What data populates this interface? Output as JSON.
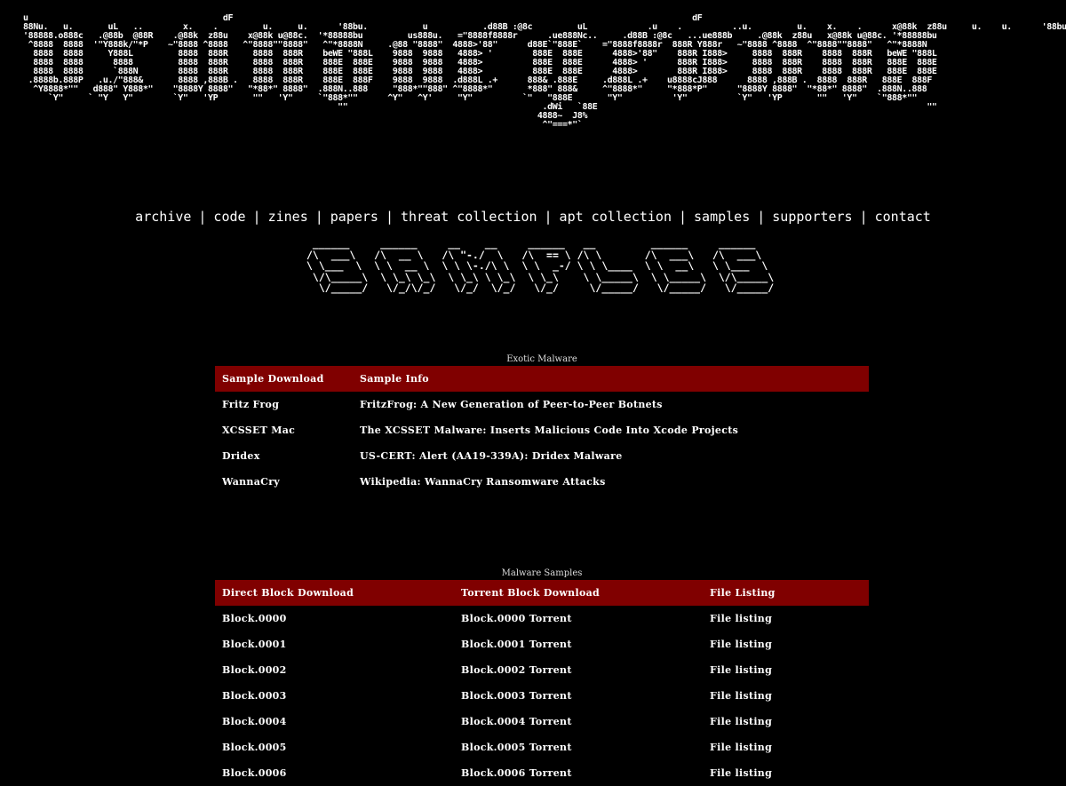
{
  "logo": {
    "ascii": "u                                       dF                                                                                            dF\n88Nu.   u.       uL   ..        x.    .         u.     u.      '88bu.           u           .d88B :@8c         uL            .u    .          ..u.         u.    x.    .      x@88k  z88u     u.    u.      '88bu.\n'88888.o888c   .@88b  @88R    .@88k  z88u    x@88k u@88c.  '*88888bu         us888u.   =\"8888f8888r      .ue888Nc..     .d88B :@8c   ...ue888b     .@88k  z88u   x@88k u@88c. '*88888bu\n ^8888  8888  '\"Y888k/\"*P    ~\"8888 ^8888   ^\"8888\"\"8888\"   ^\"*8888N     .@88 \"8888\"  4888>'88\"      d88E`\"888E`    =\"8888f8888r  888R Y888r   ~\"8888 ^8888  ^\"8888\"\"8888\"   ^\"*8888N\n  8888  8888     Y888L         8888  888R     8888  888R    beWE \"888L    9888  9888   4888> '        888E  888E      4888>'88\"    888R I888>     8888  888R    8888  888R   beWE \"888L\n  8888  8888      8888         8888  888R     8888  888R    888E  888E    9888  9888   4888>          888E  888E      4888> '      888R I888>     8888  888R    8888  888R   888E  888E\n  8888  8888      `888N        8888  888R     8888  888R    888E  888E    9888  9888   4888>          888E  888E      4888>        888R I888>     8888  888R    8888  888R   888E  888E\n .8888b.888P   .u./\"888&       8888 ,888B .   8888  888R    888E  888F    9888  9888  .d888L .+      888& .888E     .d888L .+    u8888cJ888      8888 ,888B .  8888  888R   888E  888F\n  ^Y8888*\"\"   d888\" Y888*\"    \"8888Y 8888\"   \"*88*\" 8888\"  .888N..888     \"888*\"\"888\" ^\"8888*\"       *888\" 888&     ^\"8888*\"     \"*888*P\"      \"8888Y 8888\"  \"*88*\" 8888\"  .888N..888\n     `Y\"     ` \"Y   Y\"        `Y\"   'YP       \"\"   'Y\"     `\"888*\"\"      ^Y\"   ^Y'     \"Y\"          `\"   \"888E       \"Y\"          'Y\"          `Y\"   'YP       \"\"   'Y\"    `\"888*\"\"\n                                                               \"\"                                       .dWi   `88E                                                                  \"\"\n                                                                                                       4888~  J8%\n                                                                                                        ^\"===*\"`"
  },
  "nav": {
    "items": [
      "archive",
      "code",
      "zines",
      "papers",
      "threat collection",
      "apt collection",
      "samples",
      "supporters",
      "contact"
    ],
    "separator": "|"
  },
  "banner": {
    "ascii": " ______     ______     __    __     ______   __         ______     ______\n/\\  ___\\   /\\  __ \\   /\\ \"-./  \\   /\\  == \\ /\\ \\       /\\  ___\\   /\\  ___\\\n\\ \\___  \\  \\ \\  __ \\  \\ \\ \\-./\\ \\  \\ \\  _-/ \\ \\ \\____  \\ \\  __\\   \\ \\___  \\\n \\/\\_____\\  \\ \\_\\ \\_\\  \\ \\_\\ \\ \\_\\  \\ \\_\\    \\ \\_____\\  \\ \\_____\\  \\/\\_____\\\n  \\/_____/   \\/_/\\/_/   \\/_/  \\/_/   \\/_/     \\/_____/   \\/_____/   \\/_____/"
  },
  "exotic": {
    "caption": "Exotic Malware",
    "headers": [
      "Sample Download",
      "Sample Info"
    ],
    "rows": [
      [
        "Fritz Frog",
        "FritzFrog: A New Generation of Peer-to-Peer Botnets"
      ],
      [
        "XCSSET Mac",
        "The XCSSET Malware: Inserts Malicious Code Into Xcode Projects"
      ],
      [
        "Dridex",
        "US-CERT: Alert (AA19-339A): Dridex Malware"
      ],
      [
        "WannaCry",
        "Wikipedia: WannaCry Ransomware Attacks"
      ]
    ]
  },
  "samples": {
    "caption": "Malware Samples",
    "headers": [
      "Direct Block Download",
      "Torrent Block Download",
      "File Listing"
    ],
    "rows": [
      [
        "Block.0000",
        "Block.0000 Torrent",
        "File listing"
      ],
      [
        "Block.0001",
        "Block.0001 Torrent",
        "File listing"
      ],
      [
        "Block.0002",
        "Block.0002 Torrent",
        "File listing"
      ],
      [
        "Block.0003",
        "Block.0003 Torrent",
        "File listing"
      ],
      [
        "Block.0004",
        "Block.0004 Torrent",
        "File listing"
      ],
      [
        "Block.0005",
        "Block.0005 Torrent",
        "File listing"
      ],
      [
        "Block.0006",
        "Block.0006 Torrent",
        "File listing"
      ]
    ]
  },
  "colors": {
    "background": "#000000",
    "header_row": "#800000",
    "text": "#ffffff"
  }
}
